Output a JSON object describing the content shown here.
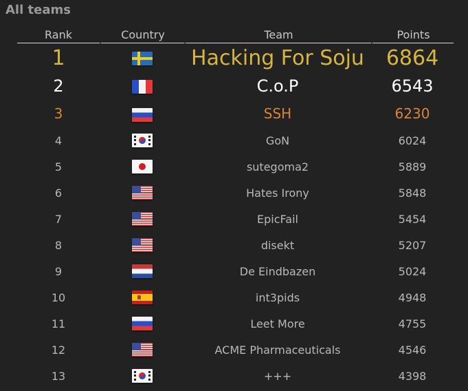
{
  "heading": "All teams",
  "columns": {
    "rank": "Rank",
    "country": "Country",
    "team": "Team",
    "points": "Points"
  },
  "rows": [
    {
      "rank": "1",
      "flag": "flag-se",
      "team": "Hacking For Soju",
      "points": "6864"
    },
    {
      "rank": "2",
      "flag": "flag-fr",
      "team": "C.o.P",
      "points": "6543"
    },
    {
      "rank": "3",
      "flag": "flag-ru",
      "team": "SSH",
      "points": "6230"
    },
    {
      "rank": "4",
      "flag": "flag-kr",
      "team": "GoN",
      "points": "6024"
    },
    {
      "rank": "5",
      "flag": "flag-jp",
      "team": "sutegoma2",
      "points": "5889"
    },
    {
      "rank": "6",
      "flag": "flag-us",
      "team": "Hates Irony",
      "points": "5848"
    },
    {
      "rank": "7",
      "flag": "flag-us",
      "team": "EpicFail",
      "points": "5454"
    },
    {
      "rank": "8",
      "flag": "flag-us",
      "team": "disekt",
      "points": "5207"
    },
    {
      "rank": "9",
      "flag": "flag-nl",
      "team": "De Eindbazen",
      "points": "5024"
    },
    {
      "rank": "10",
      "flag": "flag-es",
      "team": "int3pids",
      "points": "4948"
    },
    {
      "rank": "11",
      "flag": "flag-ru",
      "team": "Leet More",
      "points": "4755"
    },
    {
      "rank": "12",
      "flag": "flag-us",
      "team": "ACME Pharmaceuticals",
      "points": "4546"
    },
    {
      "rank": "13",
      "flag": "flag-kr",
      "team": "+++",
      "points": "4398"
    }
  ]
}
